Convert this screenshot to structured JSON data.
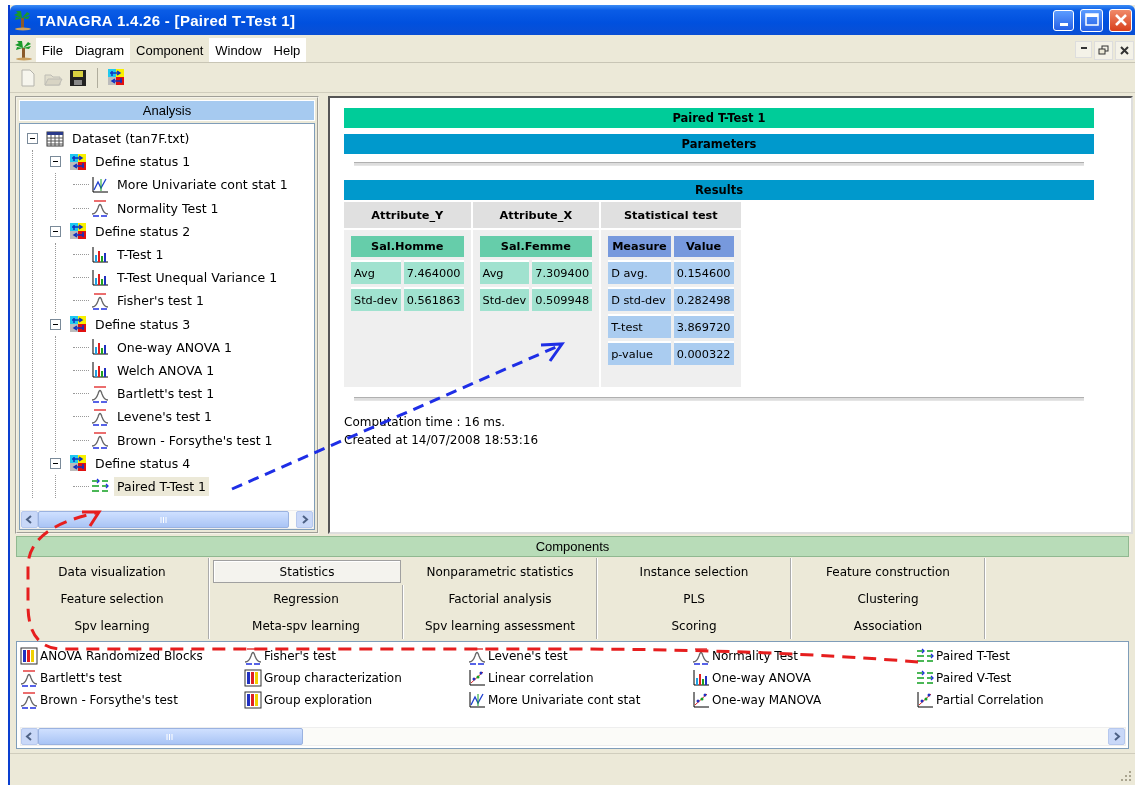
{
  "window": {
    "title": "TANAGRA 1.4.26 - [Paired T-Test 1]"
  },
  "menu": [
    {
      "label": "File",
      "selected": false
    },
    {
      "label": "Diagram",
      "selected": false
    },
    {
      "label": "Component",
      "selected": true
    },
    {
      "label": "Window",
      "selected": false
    },
    {
      "label": "Help",
      "selected": false
    }
  ],
  "toolbar": [
    {
      "kind": "new",
      "disabled": true
    },
    {
      "kind": "open",
      "disabled": true
    },
    {
      "kind": "save",
      "disabled": false
    },
    {
      "kind": "diagram",
      "disabled": false
    }
  ],
  "analysis": {
    "title": "Analysis",
    "tree": [
      {
        "label": "Dataset (tan7F.txt)",
        "kind": "dataset",
        "expanded": true,
        "selected": false,
        "children": [
          {
            "label": "Define status 1",
            "kind": "status",
            "expanded": true,
            "selected": false,
            "children": [
              {
                "label": "More Univariate cont stat 1",
                "kind": "lines",
                "selected": false
              },
              {
                "label": "Normality Test 1",
                "kind": "curve",
                "selected": false
              }
            ]
          },
          {
            "label": "Define status 2",
            "kind": "status",
            "expanded": true,
            "selected": false,
            "children": [
              {
                "label": "T-Test 1",
                "kind": "bars",
                "selected": false
              },
              {
                "label": "T-Test Unequal Variance 1",
                "kind": "bars",
                "selected": false
              },
              {
                "label": "Fisher's test 1",
                "kind": "curve",
                "selected": false
              }
            ]
          },
          {
            "label": "Define status 3",
            "kind": "status",
            "expanded": true,
            "selected": false,
            "children": [
              {
                "label": "One-way ANOVA 1",
                "kind": "bars",
                "selected": false
              },
              {
                "label": "Welch ANOVA 1",
                "kind": "bars",
                "selected": false
              },
              {
                "label": "Bartlett's test 1",
                "kind": "curve",
                "selected": false
              },
              {
                "label": "Levene's test 1",
                "kind": "curve",
                "selected": false
              },
              {
                "label": "Brown - Forsythe's test 1",
                "kind": "curve",
                "selected": false
              }
            ]
          },
          {
            "label": "Define status 4",
            "kind": "status",
            "expanded": true,
            "selected": false,
            "children": [
              {
                "label": "Paired T-Test 1",
                "kind": "arrows",
                "selected": true
              }
            ]
          }
        ]
      }
    ]
  },
  "report": {
    "title": "Paired T-Test 1",
    "parameters_heading": "Parameters",
    "results_heading": "Results",
    "groups": [
      {
        "heading": "Attribute_Y",
        "kind": "attribute",
        "variable": "Sal.Homme",
        "rows": [
          [
            "Avg",
            "7.464000"
          ],
          [
            "Std-dev",
            "0.561863"
          ]
        ]
      },
      {
        "heading": "Attribute_X",
        "kind": "attribute",
        "variable": "Sal.Femme",
        "rows": [
          [
            "Avg",
            "7.309400"
          ],
          [
            "Std-dev",
            "0.509948"
          ]
        ]
      },
      {
        "heading": "Statistical test",
        "kind": "test",
        "columns": [
          "Measure",
          "Value"
        ],
        "rows": [
          [
            "D avg.",
            "0.154600"
          ],
          [
            "D std-dev",
            "0.282498"
          ],
          [
            "T-test",
            "3.869720"
          ],
          [
            "p-value",
            "0.000322"
          ]
        ]
      }
    ],
    "footer": [
      "Computation time : 16 ms.",
      "Created at 14/07/2008 18:53:16"
    ]
  },
  "components": {
    "title": "Components",
    "tabs": [
      {
        "label": "Data visualization",
        "selected": false
      },
      {
        "label": "Statistics",
        "selected": true
      },
      {
        "label": "Nonparametric statistics",
        "selected": false
      },
      {
        "label": "Instance selection",
        "selected": false
      },
      {
        "label": "Feature construction",
        "selected": false
      },
      {
        "label": "Feature selection",
        "selected": false
      },
      {
        "label": "Regression",
        "selected": false
      },
      {
        "label": "Factorial analysis",
        "selected": false
      },
      {
        "label": "PLS",
        "selected": false
      },
      {
        "label": "Clustering",
        "selected": false
      },
      {
        "label": "Spv learning",
        "selected": false
      },
      {
        "label": "Meta-spv learning",
        "selected": false
      },
      {
        "label": "Spv learning assessment",
        "selected": false
      },
      {
        "label": "Scoring",
        "selected": false
      },
      {
        "label": "Association",
        "selected": false
      }
    ],
    "items": [
      {
        "label": "ANOVA Randomized Blocks",
        "kind": "grid"
      },
      {
        "label": "Fisher's test",
        "kind": "curve"
      },
      {
        "label": "Levene's test",
        "kind": "curve"
      },
      {
        "label": "Normality Test",
        "kind": "curve"
      },
      {
        "label": "Paired T-Test",
        "kind": "arrows"
      },
      {
        "label": "Bartlett's test",
        "kind": "curve"
      },
      {
        "label": "Group characterization",
        "kind": "grid"
      },
      {
        "label": "Linear correlation",
        "kind": "scatter"
      },
      {
        "label": "One-way ANOVA",
        "kind": "bars"
      },
      {
        "label": "Paired V-Test",
        "kind": "arrows"
      },
      {
        "label": "Brown - Forsythe's test",
        "kind": "curve"
      },
      {
        "label": "Group exploration",
        "kind": "grid"
      },
      {
        "label": "More Univariate cont stat",
        "kind": "lines"
      },
      {
        "label": "One-way MANOVA",
        "kind": "scatter"
      },
      {
        "label": "Partial Correlation",
        "kind": "scatter"
      }
    ]
  },
  "arrows": [
    {
      "color": "#1e2ee6"
    },
    {
      "color": "#e61e1e"
    }
  ]
}
